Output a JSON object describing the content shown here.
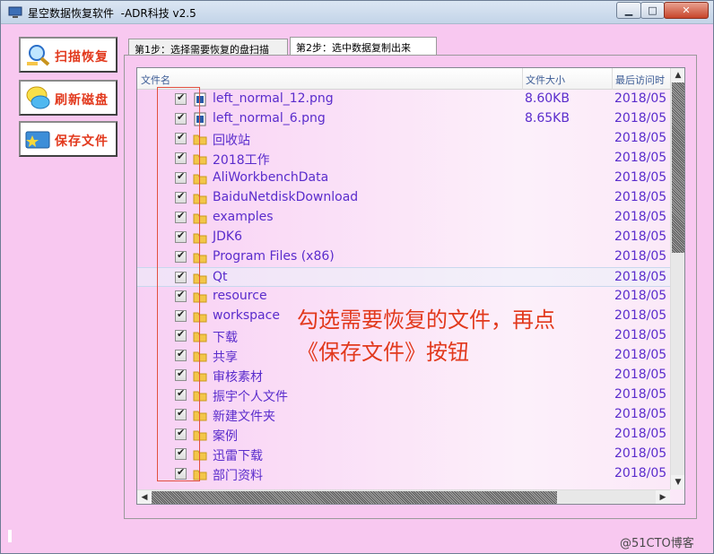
{
  "window": {
    "title": "星空数据恢复软件  -ADR科技 v2.5"
  },
  "left_buttons": [
    {
      "label": "扫描恢复",
      "icon": "magnifier-icon"
    },
    {
      "label": "刷新磁盘",
      "icon": "globe-refresh-icon"
    },
    {
      "label": "保存文件",
      "icon": "folder-star-icon"
    }
  ],
  "tabs": [
    {
      "label": "第1步：选择需要恢复的盘扫描"
    },
    {
      "label": "第2步：选中数据复制出来"
    }
  ],
  "columns": {
    "name": "文件名",
    "size": "文件大小",
    "date": "最后访问时"
  },
  "rows": [
    {
      "name": "left_normal_12.png",
      "size": "8.60KB",
      "date": "2018/05",
      "type": "image"
    },
    {
      "name": "left_normal_6.png",
      "size": "8.65KB",
      "date": "2018/05",
      "type": "image"
    },
    {
      "name": "回收站",
      "size": "",
      "date": "2018/05",
      "type": "folder"
    },
    {
      "name": "2018工作",
      "size": "",
      "date": "2018/05",
      "type": "folder"
    },
    {
      "name": "AliWorkbenchData",
      "size": "",
      "date": "2018/05",
      "type": "folder"
    },
    {
      "name": "BaiduNetdiskDownload",
      "size": "",
      "date": "2018/05",
      "type": "folder"
    },
    {
      "name": "examples",
      "size": "",
      "date": "2018/05",
      "type": "folder"
    },
    {
      "name": "JDK6",
      "size": "",
      "date": "2018/05",
      "type": "folder"
    },
    {
      "name": "Program Files (x86)",
      "size": "",
      "date": "2018/05",
      "type": "folder"
    },
    {
      "name": "Qt",
      "size": "",
      "date": "2018/05",
      "type": "folder",
      "selected": true
    },
    {
      "name": "resource",
      "size": "",
      "date": "2018/05",
      "type": "folder"
    },
    {
      "name": "workspace",
      "size": "",
      "date": "2018/05",
      "type": "folder"
    },
    {
      "name": "下载",
      "size": "",
      "date": "2018/05",
      "type": "folder"
    },
    {
      "name": "共享",
      "size": "",
      "date": "2018/05",
      "type": "folder"
    },
    {
      "name": "审核素材",
      "size": "",
      "date": "2018/05",
      "type": "folder"
    },
    {
      "name": "振宇个人文件",
      "size": "",
      "date": "2018/05",
      "type": "folder"
    },
    {
      "name": "新建文件夹",
      "size": "",
      "date": "2018/05",
      "type": "folder"
    },
    {
      "name": "案例",
      "size": "",
      "date": "2018/05",
      "type": "folder"
    },
    {
      "name": "迅雷下载",
      "size": "",
      "date": "2018/05",
      "type": "folder"
    },
    {
      "name": "部门资料",
      "size": "",
      "date": "2018/05",
      "type": "folder"
    }
  ],
  "annotation": {
    "line1": "勾选需要恢复的文件，再点",
    "line2": "《保存文件》按钮"
  },
  "watermark": "@51CTO博客",
  "colors": {
    "accent": "#e2391d",
    "file_text": "#5a2ccc",
    "background": "#f8c8f0"
  }
}
